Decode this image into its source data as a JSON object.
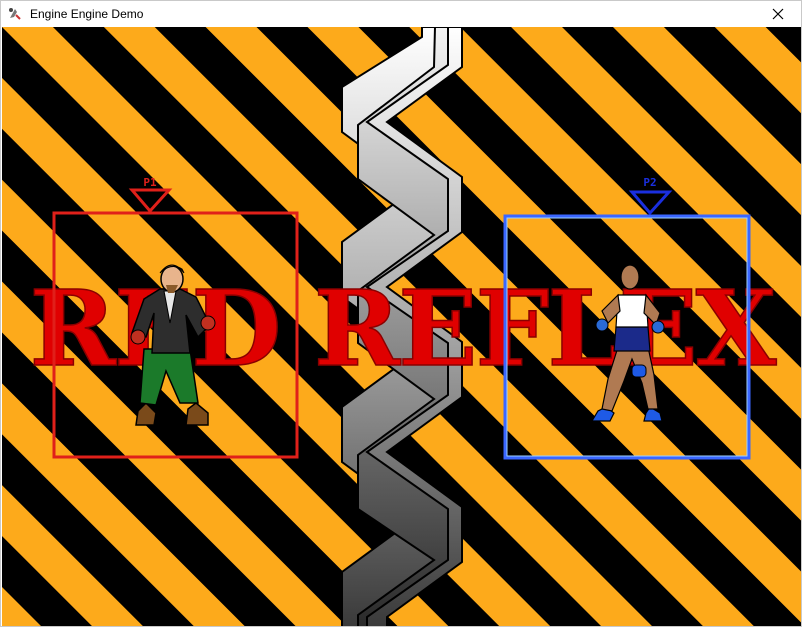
{
  "window": {
    "title": "Engine Engine Demo",
    "icon": "app-icon",
    "close_icon": "close-icon"
  },
  "game": {
    "logo_text": "RED REFLEX",
    "stripe_colors": [
      "#fdaa1b",
      "#000000"
    ],
    "player1": {
      "label": "P1",
      "color": "#e0201a"
    },
    "player2": {
      "label": "P2",
      "color": "#1a2fe0",
      "frame_color": "#3a66ff"
    }
  }
}
